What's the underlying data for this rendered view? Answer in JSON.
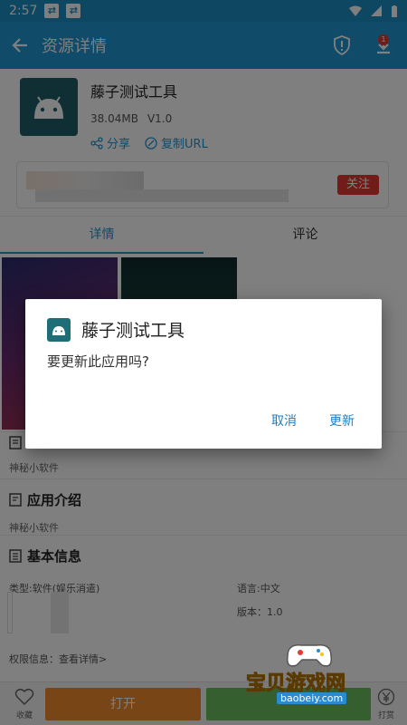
{
  "status_bar": {
    "time": "2:57",
    "battery_glyph": "▮"
  },
  "app_bar": {
    "title": "资源详情",
    "badge": "1"
  },
  "app": {
    "name": "藤子测试工具",
    "size": "38.04MB",
    "version": "V1.0",
    "share_label": "分享",
    "copy_url_label": "复制URL"
  },
  "author": {
    "follow_label": "关注"
  },
  "tabs": [
    {
      "label": "详情"
    },
    {
      "label": "评论"
    }
  ],
  "sections": {
    "s1": {
      "text": "神秘小软件"
    },
    "intro": {
      "title": "应用介绍",
      "text": "神秘小软件"
    },
    "basic": {
      "title": "基本信息",
      "type": "类型:软件(娱乐消遣)",
      "language": "语言:中文",
      "version": "版本：1.0",
      "permissions": "权限信息：查看详情>"
    }
  },
  "bottom_bar": {
    "fav_label": "收藏",
    "open_label": "打开",
    "tip_label": "打赏"
  },
  "watermark": {
    "text": "宝贝游戏网",
    "url": "baobeiy.com"
  },
  "dialog": {
    "title": "藤子测试工具",
    "message": "要更新此应用吗?",
    "cancel_label": "取消",
    "update_label": "更新"
  },
  "colors": {
    "primary": "#2196d3",
    "status": "#1d8fc4",
    "accent_red": "#e53935",
    "open_orange": "#f08c2c",
    "green": "#6bbf5e"
  }
}
